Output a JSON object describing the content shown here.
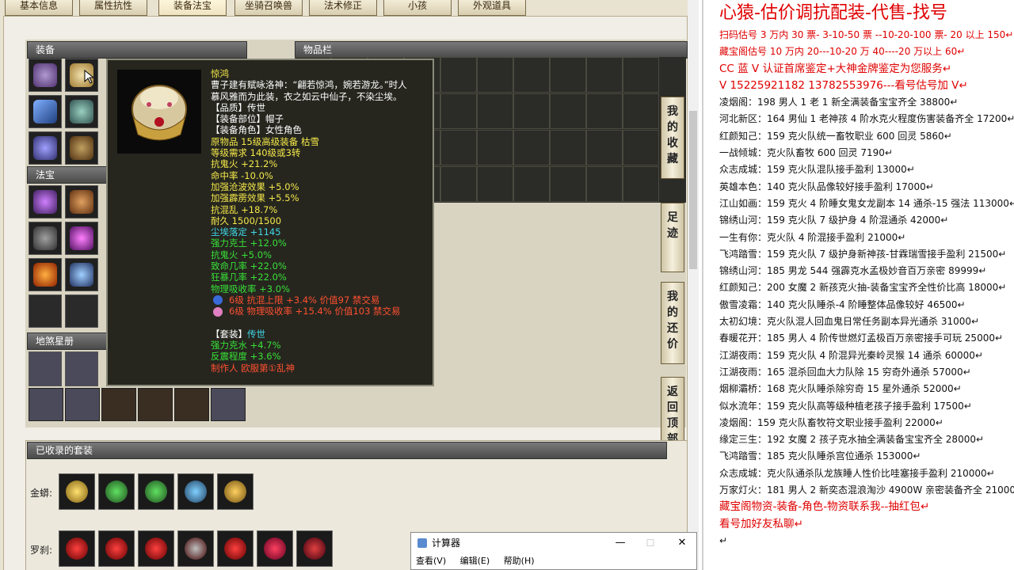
{
  "tabs": [
    "基本信息",
    "属性抗性",
    "装备法宝",
    "坐骑召唤兽",
    "法术修正",
    "小孩",
    "外观道具"
  ],
  "sections": {
    "equipment": "装备",
    "inventory": "物品栏",
    "treasure": "法宝",
    "star": "地煞星册",
    "suits": "已收录的套装"
  },
  "side_buttons": [
    "我的收藏",
    "足迹",
    "我的还价",
    "返回顶部"
  ],
  "suit_rows": [
    {
      "label": "金蟒:"
    },
    {
      "label": "罗刹:"
    }
  ],
  "tooltip": {
    "lines": [
      {
        "t": "惊鸿",
        "c": "y"
      },
      {
        "t": "曹子建有赋咏洛神：“翩若惊鸿，婉若游龙。”时人",
        "c": "w"
      },
      {
        "t": "慕风雅而为此装，衣之如云中仙子，不染尘埃。",
        "c": "w"
      },
      {
        "t": "【品质】传世",
        "c": "w"
      },
      {
        "t": "【装备部位】帽子",
        "c": "w"
      },
      {
        "t": "【装备角色】女性角色",
        "c": "w"
      },
      {
        "t": "原物品 15级高级装备 枯雪",
        "c": "y"
      },
      {
        "t": "等级需求 140级或3转",
        "c": "y"
      },
      {
        "t": "抗鬼火 +21.2%",
        "c": "y"
      },
      {
        "t": "命中率 -10.0%",
        "c": "y"
      },
      {
        "t": "加强沧波效果 +5.0%",
        "c": "y"
      },
      {
        "t": "加强霹雳效果 +5.5%",
        "c": "y"
      },
      {
        "t": "抗混乱 +18.7%",
        "c": "y"
      },
      {
        "t": "耐久 1500/1500",
        "c": "y"
      },
      {
        "t": "尘埃落定 +1145",
        "c": "c"
      },
      {
        "t": "强力克土 +12.0%",
        "c": "g"
      },
      {
        "t": "抗鬼火 +5.0%",
        "c": "g"
      },
      {
        "t": "致命几率 +22.0%",
        "c": "g"
      },
      {
        "t": "狂暴几率 +22.0%",
        "c": "g"
      },
      {
        "t": "物理吸收率 +3.0%",
        "c": "g"
      },
      {
        "t": "6级 抗混上限 +3.4% 价值97 禁交易",
        "c": "r",
        "gem": "#3a6ad8"
      },
      {
        "t": "6级 物理吸收率 +15.4% 价值103 禁交易",
        "c": "r",
        "gem": "#e080c0"
      },
      {
        "t": "",
        "c": "w"
      },
      {
        "t": "【套装】传世",
        "c": "w",
        "suffix": "传世"
      },
      {
        "t": "强力克水 +4.7%",
        "c": "g"
      },
      {
        "t": "反震程度 +3.6%",
        "c": "g"
      },
      {
        "t": "制作人 欧服第①乱神",
        "c": "r"
      }
    ]
  },
  "calculator": {
    "title": "计算器",
    "menu": [
      "查看(V)",
      "编辑(E)",
      "帮助(H)"
    ],
    "controls": {
      "min": "—",
      "max": "☐",
      "close": "✕"
    }
  },
  "right_panel": {
    "title": "心猿-估价调抗配装-代售-找号",
    "red_lines": [
      "扫码估号 3 万内 30 票- 3-10-50 票  --10-20-100 票- 20 以上 150↵",
      "藏宝阁估号 10 万内 20---10-20 万 40----20 万以上 60↵",
      "CC 蓝 V 认证首席鉴定+大神金牌鉴定为您服务↵",
      "V 15225921182      13782553976---看号估号加 V↵"
    ],
    "lines": [
      "凌烟阁：198 男人 1 老 1 新全满装备宝宝齐全 38800↵",
      "河北新区：164 男仙 1 老神孩 4 阶水克火程度伤害装备齐全 17200↵",
      "红颜知己：159 克火队统一畜牧职业 600 回灵 5860↵",
      "一战倾城：克火队畜牧 600 回灵 7190↵",
      "众志成城：159 克火队混队接手盈利 13000↵",
      "英雄本色：140 克火队品像较好接手盈利 17000↵",
      "江山如画：159 克火 4 阶睡女鬼女龙副本 14 通杀-15 强法 113000↵",
      "锦绣山河：159 克火队 7 级护身 4 阶混通杀 42000↵",
      "一生有你：克火队 4 阶混接手盈利 21000↵",
      "飞鸿踏雪：159 克火队 7 级护身新神孩-甘霖瑞雪接手盈利 21500↵",
      "锦绣山河：185 男龙 544 强霹克水孟极妙音百万亲密 89999↵",
      "红颜知己：200 女魔 2 新孩克火抽-装备宝宝齐全性价比高 18000↵",
      "傲雪凌霜：140 克火队睡杀-4 阶睡整体品像较好 46500↵",
      "太初幻境：克火队混人回血鬼日常任务副本异光通杀 31000↵",
      "春暖花开：185 男人 4 阶传世燃灯孟极百万亲密接手可玩 25000↵",
      "江湖夜雨：159 克火队 4 阶混异光秦岭灵猴 14 通杀 60000↵",
      "江湖夜雨：165 混杀回血大力队除 15 穷奇外通杀 57000↵",
      "烟柳灞桥：168 克火队睡杀除穷奇 15 星外通杀 52000↵",
      "似水流年：159 克火队高等级种植老孩子接手盈利 17500↵",
      "凌烟阁：159 克火队畜牧符文职业接手盈利 22000↵",
      "缘定三生：192 女魔 2 孩子克水抽全满装备宝宝齐全 28000↵",
      "飞鸿踏雪：185 克火队睡杀宫位通杀 153000↵",
      "众志成城：克火队通杀队龙族睡人性价比哇塞接手盈利 210000↵",
      "万家灯火：181 男人 2 新奕态混浪淘沙 4900W 亲密装备齐全 210000↵"
    ],
    "footer": [
      "藏宝阁物资-装备-角色-物资联系我--抽红包↵",
      "看号加好友私聊↵",
      "↵"
    ]
  }
}
